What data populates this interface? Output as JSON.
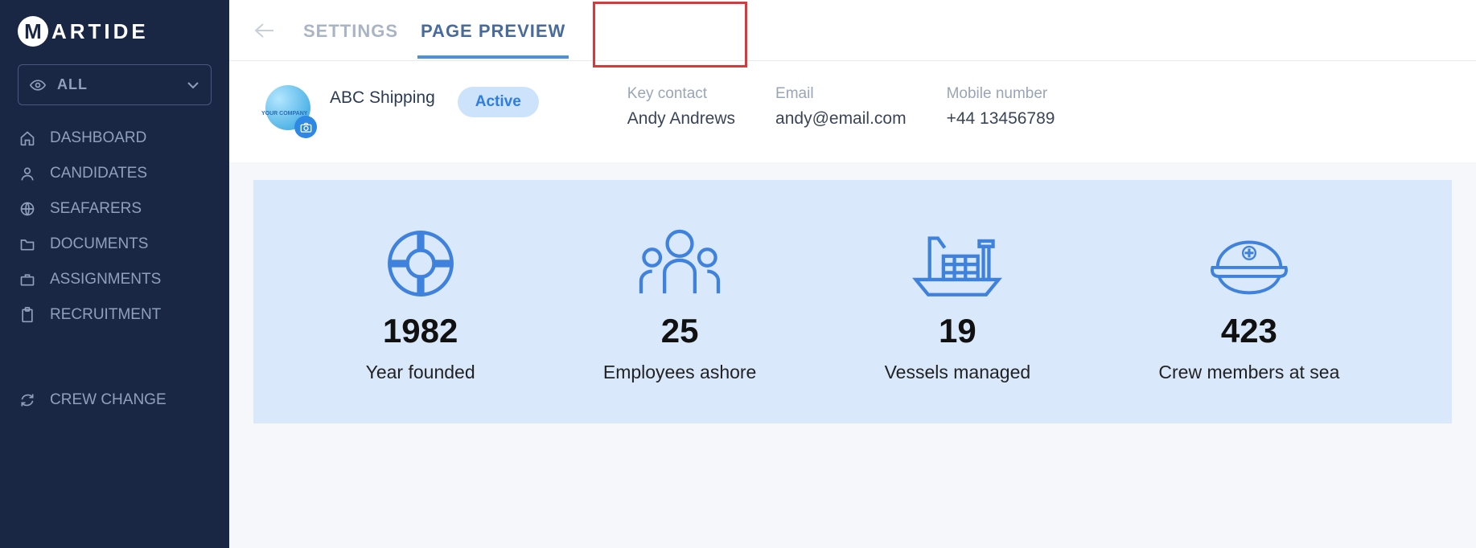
{
  "brand": {
    "name": "ARTIDE",
    "mark": "M"
  },
  "sidebar": {
    "filter_label": "ALL",
    "items": [
      {
        "icon": "home",
        "label": "DASHBOARD"
      },
      {
        "icon": "user",
        "label": "CANDIDATES"
      },
      {
        "icon": "globe",
        "label": "SEAFARERS"
      },
      {
        "icon": "folder",
        "label": "DOCUMENTS"
      },
      {
        "icon": "brief",
        "label": "ASSIGNMENTS"
      },
      {
        "icon": "clip",
        "label": "RECRUITMENT"
      }
    ],
    "footer_item": {
      "icon": "sync",
      "label": "CREW CHANGE"
    }
  },
  "tabs": {
    "settings": "SETTINGS",
    "preview": "PAGE PREVIEW"
  },
  "company": {
    "avatar_text": "YOUR COMPANY",
    "name": "ABC Shipping",
    "status": "Active"
  },
  "contacts": [
    {
      "label": "Key contact",
      "value": "Andy Andrews"
    },
    {
      "label": "Email",
      "value": "andy@email.com"
    },
    {
      "label": "Mobile number",
      "value": "+44 13456789"
    }
  ],
  "stats": [
    {
      "icon": "lifebuoy",
      "value": "1982",
      "label": "Year founded"
    },
    {
      "icon": "crew",
      "value": "25",
      "label": "Employees ashore"
    },
    {
      "icon": "ship",
      "value": "19",
      "label": "Vessels managed"
    },
    {
      "icon": "cap",
      "value": "423",
      "label": "Crew members at sea"
    }
  ]
}
